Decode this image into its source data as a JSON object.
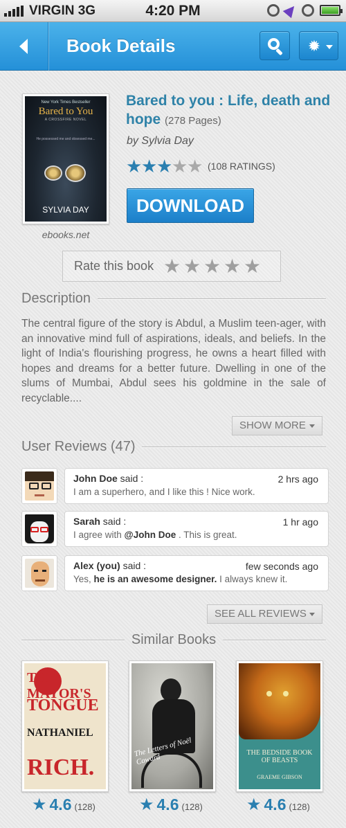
{
  "status_bar": {
    "carrier": "VIRGIN 3G",
    "time": "4:20 PM"
  },
  "nav": {
    "title": "Book Details"
  },
  "book": {
    "title": "Bared to you : Life, death and hope",
    "pages": "(278 Pages)",
    "author": "by Sylvia Day",
    "rating_stars": 3,
    "ratings_count": "(108 RATINGS)",
    "download_label": "DOWNLOAD",
    "source": "ebooks.net",
    "cover": {
      "top_line": "New York Times Bestseller",
      "title": "Bared to You",
      "series": "A CROSSFIRE NOVEL",
      "tagline": "He possessed me and obsessed me...",
      "author": "SYLVIA DAY"
    }
  },
  "rate": {
    "label": "Rate this book"
  },
  "description": {
    "heading": "Description",
    "text": "The central figure of the story is Abdul, a Muslim teen-ager, with an innovative mind full of aspirations, ideals, and beliefs. In the light of India's flourishing progress, he owns a heart filled with hopes and dreams for a better future. Dwelling in one of the slums of Mumbai, Abdul sees his goldmine in the sale of recyclable....",
    "show_more": "SHOW MORE"
  },
  "reviews": {
    "heading": "User Reviews (47)",
    "items": [
      {
        "name": "John Doe",
        "said": " said :",
        "time": "2 hrs ago",
        "pre": "I am a superhero, and I like this ! Nice work.",
        "bold": "",
        "post": ""
      },
      {
        "name": "Sarah",
        "said": " said :",
        "time": "1 hr ago",
        "pre": "I agree with ",
        "bold": "@John Doe",
        "post": " . This is great."
      },
      {
        "name": "Alex (you)",
        "said": " said :",
        "time": "few seconds ago",
        "pre": "Yes, ",
        "bold": "he is an awesome designer.",
        "post": " I always knew it."
      }
    ],
    "see_all": "SEE ALL REVIEWS"
  },
  "similar": {
    "heading": "Similar Books",
    "books": [
      {
        "rating": "4.6",
        "count": "(128)",
        "title_lines": [
          "THE MAYOR'S",
          "TONGUE",
          "NATHANIEL",
          "RICH."
        ]
      },
      {
        "rating": "4.6",
        "count": "(128)",
        "title": "The Letters of Noël Coward"
      },
      {
        "rating": "4.6",
        "count": "(128)",
        "title": "The Bedside Book of Beasts",
        "author": "GRAEME GIBSON"
      }
    ]
  },
  "colors": {
    "accent": "#2a7fb0",
    "nav_blue": "#2f9de0",
    "title_blue": "#2e82a8"
  }
}
